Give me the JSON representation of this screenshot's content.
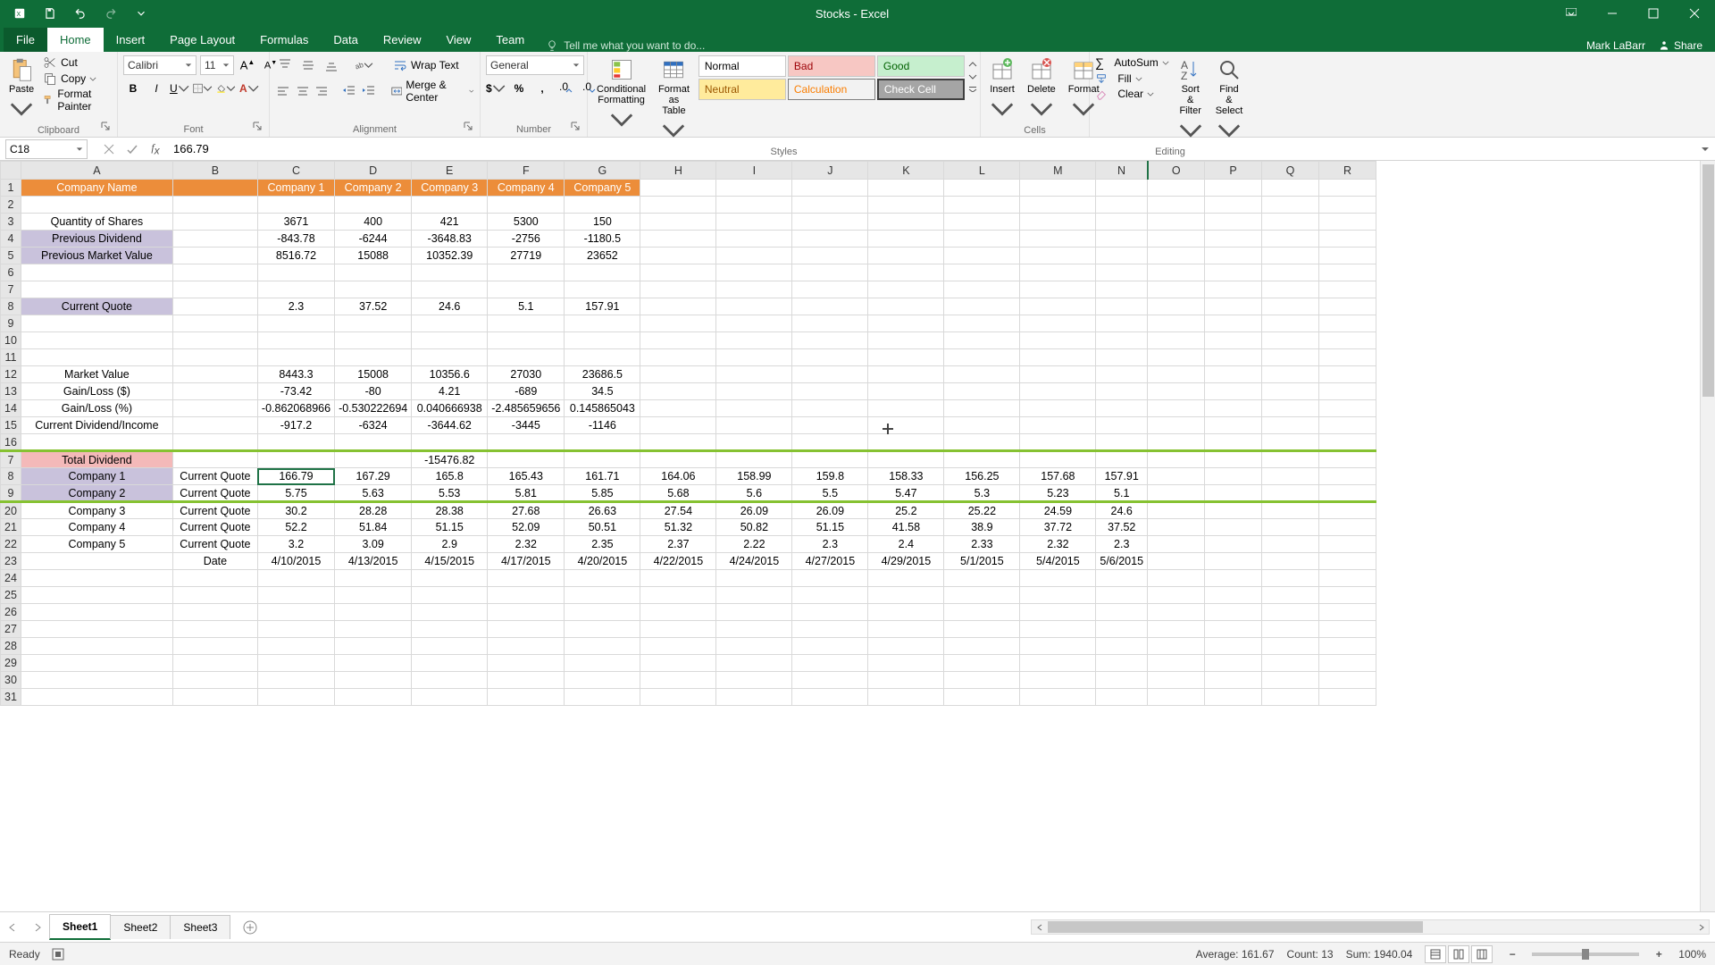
{
  "titlebar": {
    "title": "Stocks - Excel"
  },
  "tabs": {
    "file": "File",
    "home": "Home",
    "insert": "Insert",
    "page_layout": "Page Layout",
    "formulas": "Formulas",
    "data": "Data",
    "review": "Review",
    "view": "View",
    "team": "Team",
    "tellme": "Tell me what you want to do..."
  },
  "signin": {
    "name": "Mark LaBarr",
    "share": "Share"
  },
  "ribbon": {
    "clipboard": {
      "paste": "Paste",
      "cut": "Cut",
      "copy": "Copy",
      "format_painter": "Format Painter",
      "label": "Clipboard"
    },
    "font": {
      "name": "Calibri",
      "size": "11",
      "label": "Font"
    },
    "alignment": {
      "wrap": "Wrap Text",
      "merge": "Merge & Center",
      "label": "Alignment"
    },
    "number": {
      "format": "General",
      "label": "Number"
    },
    "styles": {
      "cond": "Conditional Formatting",
      "fat": "Format as Table",
      "normal": "Normal",
      "bad": "Bad",
      "good": "Good",
      "neutral": "Neutral",
      "calculation": "Calculation",
      "check": "Check Cell",
      "label": "Styles"
    },
    "cells": {
      "insert": "Insert",
      "delete": "Delete",
      "format": "Format",
      "label": "Cells"
    },
    "editing": {
      "autosum": "AutoSum",
      "fill": "Fill",
      "clear": "Clear",
      "sort": "Sort & Filter",
      "find": "Find & Select",
      "label": "Editing"
    }
  },
  "fxbar": {
    "namebox": "C18",
    "formula": "166.79"
  },
  "columns": [
    "A",
    "B",
    "C",
    "D",
    "E",
    "F",
    "G",
    "H",
    "I",
    "J",
    "K",
    "L",
    "M",
    "N",
    "O",
    "P",
    "Q",
    "R"
  ],
  "rows_top": [
    "1",
    "2",
    "3",
    "4",
    "5",
    "6",
    "7",
    "8",
    "9",
    "10",
    "11",
    "12",
    "13",
    "14",
    "15",
    "16"
  ],
  "rows_bot": [
    "7",
    "8",
    "9",
    "20",
    "21",
    "22",
    "23",
    "24",
    "25",
    "26",
    "27",
    "28",
    "29",
    "30",
    "31"
  ],
  "sheet": {
    "header": {
      "a": "Company Name",
      "c": "Company 1",
      "d": "Company 2",
      "e": "Company 3",
      "f": "Company 4",
      "g": "Company 5"
    },
    "r3": {
      "a": "Quantity of Shares",
      "c": "3671",
      "d": "400",
      "e": "421",
      "f": "5300",
      "g": "150"
    },
    "r4": {
      "a": "Previous Dividend",
      "c": "-843.78",
      "d": "-6244",
      "e": "-3648.83",
      "f": "-2756",
      "g": "-1180.5"
    },
    "r5": {
      "a": "Previous Market Value",
      "c": "8516.72",
      "d": "15088",
      "e": "10352.39",
      "f": "27719",
      "g": "23652"
    },
    "r8": {
      "a": "Current Quote",
      "c": "2.3",
      "d": "37.52",
      "e": "24.6",
      "f": "5.1",
      "g": "157.91"
    },
    "r12": {
      "a": "Market Value",
      "c": "8443.3",
      "d": "15008",
      "e": "10356.6",
      "f": "27030",
      "g": "23686.5"
    },
    "r13": {
      "a": "Gain/Loss ($)",
      "c": "-73.42",
      "d": "-80",
      "e": "4.21",
      "f": "-689",
      "g": "34.5"
    },
    "r14": {
      "a": "Gain/Loss (%)",
      "c": "-0.862068966",
      "d": "-0.530222694",
      "e": "0.040666938",
      "f": "-2.485659656",
      "g": "0.145865043"
    },
    "r15": {
      "a": "Current Dividend/Income",
      "c": "-917.2",
      "d": "-6324",
      "e": "-3644.62",
      "f": "-3445",
      "g": "-1146"
    },
    "b7": {
      "a": "Total Dividend",
      "e": "-15476.82"
    },
    "b8": {
      "a": "Company 1",
      "b": "Current Quote",
      "vals": [
        "166.79",
        "167.29",
        "165.8",
        "165.43",
        "161.71",
        "164.06",
        "158.99",
        "159.8",
        "158.33",
        "156.25",
        "157.68",
        "157.91"
      ]
    },
    "b9": {
      "a": "Company 2",
      "b": "Current Quote",
      "vals": [
        "5.75",
        "5.63",
        "5.53",
        "5.81",
        "5.85",
        "5.68",
        "5.6",
        "5.5",
        "5.47",
        "5.3",
        "5.23",
        "5.1"
      ]
    },
    "b20": {
      "a": "Company 3",
      "b": "Current Quote",
      "vals": [
        "30.2",
        "28.28",
        "28.38",
        "27.68",
        "26.63",
        "27.54",
        "26.09",
        "26.09",
        "25.2",
        "25.22",
        "24.59",
        "24.6"
      ]
    },
    "b21": {
      "a": "Company 4",
      "b": "Current Quote",
      "vals": [
        "52.2",
        "51.84",
        "51.15",
        "52.09",
        "50.51",
        "51.32",
        "50.82",
        "51.15",
        "41.58",
        "38.9",
        "37.72",
        "37.52"
      ]
    },
    "b22": {
      "a": "Company 5",
      "b": "Current Quote",
      "vals": [
        "3.2",
        "3.09",
        "2.9",
        "2.32",
        "2.35",
        "2.37",
        "2.22",
        "2.3",
        "2.4",
        "2.33",
        "2.32",
        "2.3"
      ]
    },
    "b23": {
      "b": "Date",
      "vals": [
        "4/10/2015",
        "4/13/2015",
        "4/15/2015",
        "4/17/2015",
        "4/20/2015",
        "4/22/2015",
        "4/24/2015",
        "4/27/2015",
        "4/29/2015",
        "5/1/2015",
        "5/4/2015",
        "5/6/2015"
      ]
    }
  },
  "sheets": {
    "s1": "Sheet1",
    "s2": "Sheet2",
    "s3": "Sheet3"
  },
  "status": {
    "ready": "Ready",
    "avg": "Average: 161.67",
    "count": "Count: 13",
    "sum": "Sum: 1940.04",
    "zoom": "100%"
  },
  "chart_data": {
    "type": "table",
    "title": "Stocks",
    "companies": [
      "Company 1",
      "Company 2",
      "Company 3",
      "Company 4",
      "Company 5"
    ],
    "quantity_of_shares": [
      3671,
      400,
      421,
      5300,
      150
    ],
    "previous_dividend": [
      -843.78,
      -6244,
      -3648.83,
      -2756,
      -1180.5
    ],
    "previous_market_value": [
      8516.72,
      15088,
      10352.39,
      27719,
      23652
    ],
    "current_quote": [
      2.3,
      37.52,
      24.6,
      5.1,
      157.91
    ],
    "market_value": [
      8443.3,
      15008,
      10356.6,
      27030,
      23686.5
    ],
    "gain_loss_dollar": [
      -73.42,
      -80,
      4.21,
      -689,
      34.5
    ],
    "gain_loss_pct": [
      -0.862068966,
      -0.530222694,
      0.040666938,
      -2.485659656,
      0.145865043
    ],
    "current_dividend_income": [
      -917.2,
      -6324,
      -3644.62,
      -3445,
      -1146
    ],
    "total_dividend": -15476.82,
    "dates": [
      "4/10/2015",
      "4/13/2015",
      "4/15/2015",
      "4/17/2015",
      "4/20/2015",
      "4/22/2015",
      "4/24/2015",
      "4/27/2015",
      "4/29/2015",
      "5/1/2015",
      "5/4/2015",
      "5/6/2015"
    ],
    "history": {
      "Company 1": [
        166.79,
        167.29,
        165.8,
        165.43,
        161.71,
        164.06,
        158.99,
        159.8,
        158.33,
        156.25,
        157.68,
        157.91
      ],
      "Company 2": [
        5.75,
        5.63,
        5.53,
        5.81,
        5.85,
        5.68,
        5.6,
        5.5,
        5.47,
        5.3,
        5.23,
        5.1
      ],
      "Company 3": [
        30.2,
        28.28,
        28.38,
        27.68,
        26.63,
        27.54,
        26.09,
        26.09,
        25.2,
        25.22,
        24.59,
        24.6
      ],
      "Company 4": [
        52.2,
        51.84,
        51.15,
        52.09,
        50.51,
        51.32,
        50.82,
        51.15,
        41.58,
        38.9,
        37.72,
        37.52
      ],
      "Company 5": [
        3.2,
        3.09,
        2.9,
        2.32,
        2.35,
        2.37,
        2.22,
        2.3,
        2.4,
        2.33,
        2.32,
        2.3
      ]
    }
  }
}
